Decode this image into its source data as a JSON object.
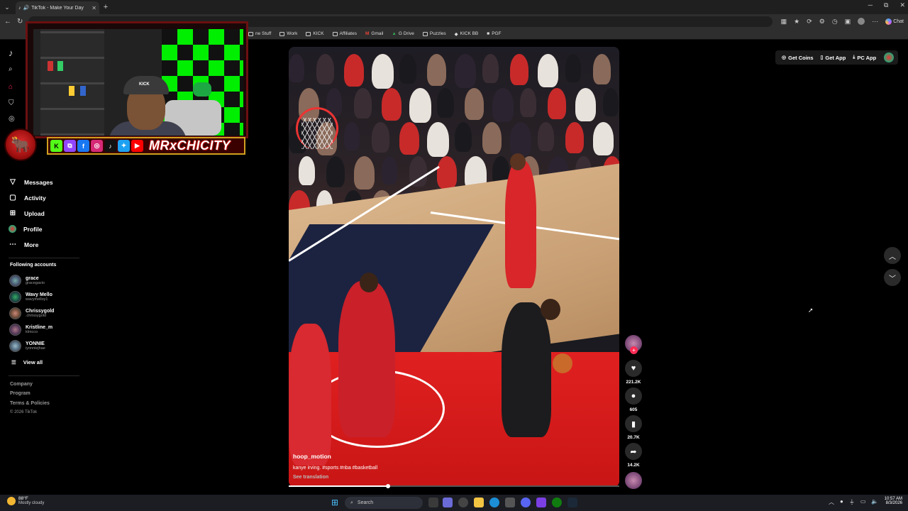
{
  "browser": {
    "tab_title": "TikTok - Make Your Day",
    "new_tab": "+",
    "chat_label": "Chat",
    "window_controls": [
      "─",
      "⧉",
      "✕"
    ],
    "bookmarks": [
      {
        "icon": "folder-icon",
        "label": "ne Stuff"
      },
      {
        "icon": "folder-icon",
        "label": "Work"
      },
      {
        "icon": "folder-icon",
        "label": "KICK"
      },
      {
        "icon": "folder-icon",
        "label": "Affiliates"
      },
      {
        "icon": "gmail-icon",
        "label": "Gmail"
      },
      {
        "icon": "gdrive-icon",
        "label": "G Drive"
      },
      {
        "icon": "folder-icon",
        "label": "Puzzles"
      },
      {
        "icon": "kick-icon",
        "label": "KICK BB"
      },
      {
        "icon": "pgf-icon",
        "label": "PGF"
      }
    ]
  },
  "sidebar": {
    "nav": [
      {
        "icon": "messages-icon",
        "label": "Messages"
      },
      {
        "icon": "activity-icon",
        "label": "Activity"
      },
      {
        "icon": "upload-icon",
        "label": "Upload"
      },
      {
        "icon": "profile-icon",
        "label": "Profile"
      },
      {
        "icon": "more-icon",
        "label": "More"
      }
    ],
    "following_title": "Following accounts",
    "accounts": [
      {
        "name": "grace",
        "handle": "gracegavio"
      },
      {
        "name": "Wavy Mello",
        "handle": "wavymelloy1"
      },
      {
        "name": "Chrissygold",
        "handle": ".chrissygold"
      },
      {
        "name": "Kristline_m",
        "handle": "klmcco"
      },
      {
        "name": "YONNIE",
        "handle": "iyonniejhae"
      }
    ],
    "view_all": "View all",
    "footer": [
      "Company",
      "Program",
      "Terms & Policies"
    ],
    "copyright": "© 2026 TikTok"
  },
  "overlay": {
    "channel_name": "MRxCHICITY",
    "cap_text": "KICK"
  },
  "video": {
    "username": "hoop_motion",
    "caption": "kanye irving. #sports #nba #basketball",
    "see_translation": "See translation",
    "progress": 0.3
  },
  "actions": {
    "likes": "221.2K",
    "comments": "605",
    "saves": "20.7K",
    "shares": "14.2K"
  },
  "top_buttons": {
    "coins": "Get Coins",
    "app": "Get App",
    "pc_app": "PC App"
  },
  "taskbar": {
    "temp": "88°F",
    "condition": "Mostly cloudy",
    "search": "Search",
    "time": "10:57 AM",
    "date": "8/3/2026"
  },
  "colors": {
    "tiktok_red": "#fe2c55",
    "overlay_red": "#6b1010",
    "accent_blue": "#4cc2ff"
  }
}
